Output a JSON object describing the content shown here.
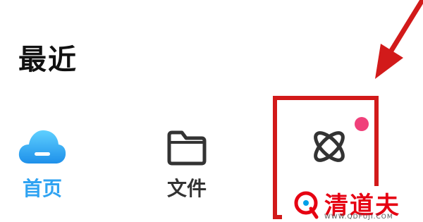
{
  "header": {
    "title": "最近"
  },
  "nav": {
    "home": {
      "label": "首页",
      "icon": "cloud-icon"
    },
    "files": {
      "label": "文件",
      "icon": "folder-icon"
    },
    "discover": {
      "label": "",
      "icon": "atom-icon"
    }
  },
  "watermark": {
    "name": "清道夫",
    "domain": "WWW.QDFUJI.COM"
  },
  "colors": {
    "accent": "#2fa3f2",
    "badge": "#f0407a",
    "highlight": "#d21a1a",
    "watermark": "#e60012"
  }
}
